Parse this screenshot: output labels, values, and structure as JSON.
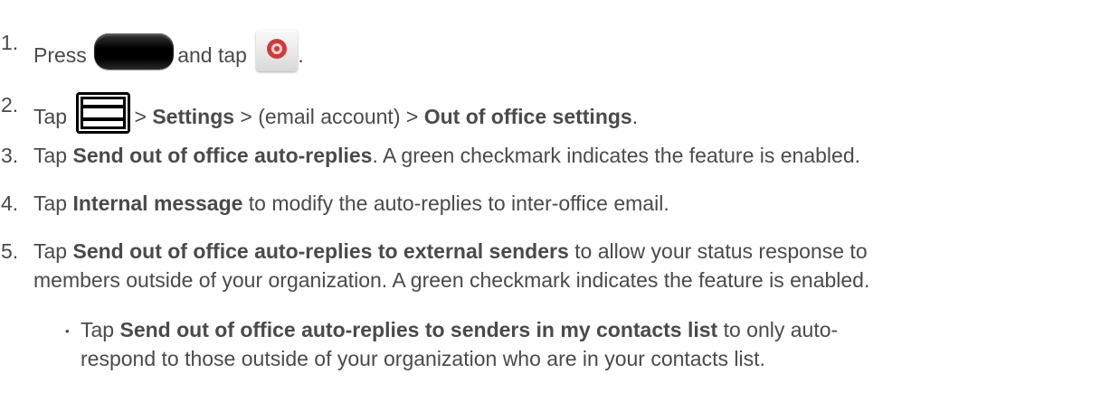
{
  "steps": [
    {
      "num": "1.",
      "parts": [
        "Press",
        "and tap",
        "."
      ]
    },
    {
      "num": "2.",
      "parts": [
        "Tap",
        "> ",
        "Settings",
        " > (email account) > ",
        "Out of office settings",
        "."
      ]
    },
    {
      "num": "3.",
      "parts": [
        "Tap ",
        "Send out of office auto-replies",
        ". A green checkmark indicates the feature is enabled."
      ]
    },
    {
      "num": "4.",
      "parts": [
        "Tap ",
        "Internal message",
        " to modify the auto-replies to inter-office email."
      ]
    },
    {
      "num": "5.",
      "parts": [
        "Tap ",
        "Send out of office auto-replies to external senders",
        " to allow your status response to",
        "members outside of your organization. A green checkmark indicates the feature is enabled."
      ]
    }
  ],
  "sub_bullet": {
    "bullet": "•",
    "parts": [
      "Tap ",
      "Send out of office auto-replies to senders in my contacts list",
      " to only auto-",
      "respond to those outside of your organization who are in your contacts list."
    ]
  },
  "icons": {
    "home_key": "home-key-icon",
    "email_app": "email-app-icon",
    "menu_key": "menu-key-icon"
  }
}
